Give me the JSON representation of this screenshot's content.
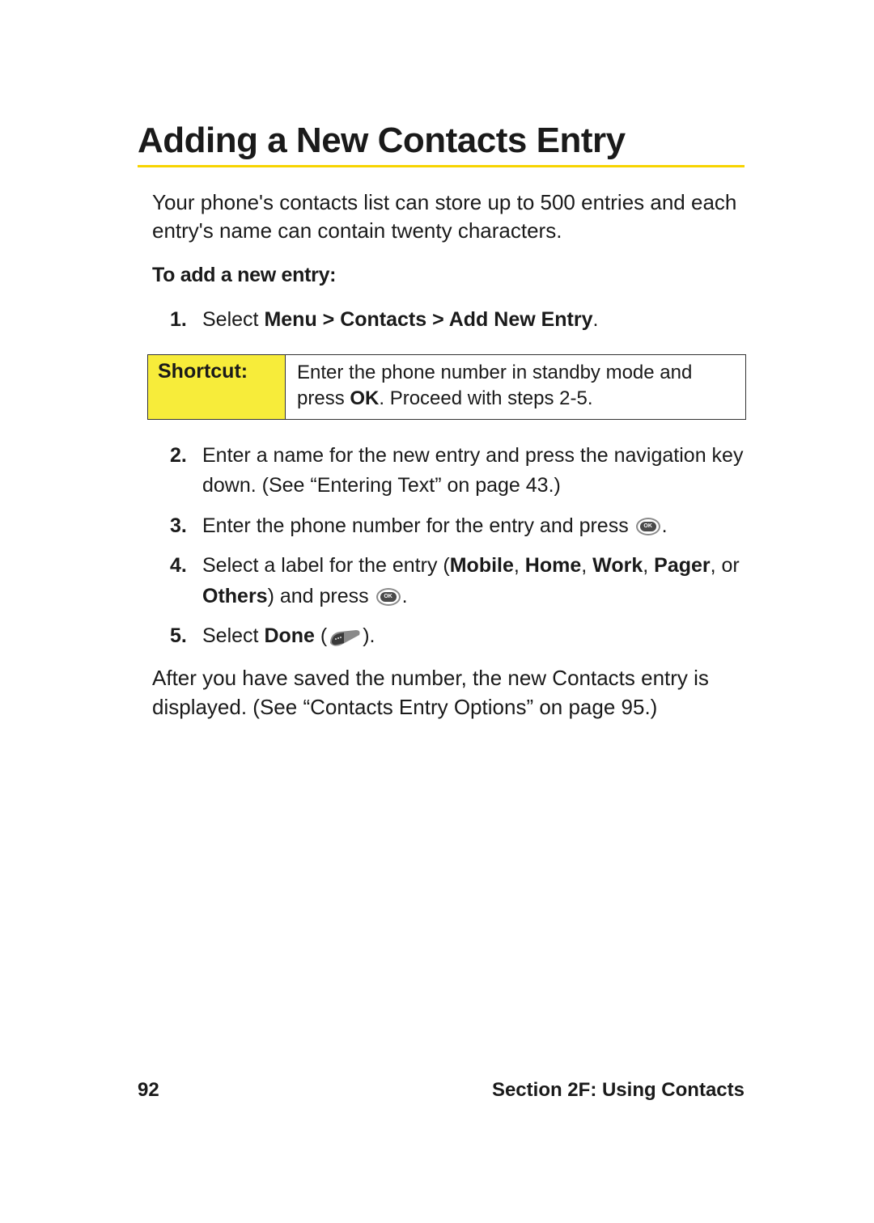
{
  "title": "Adding a New Contacts Entry",
  "intro": "Your phone's contacts list can store up to 500 entries and each entry's name can contain twenty characters.",
  "subhead": "To add a new entry:",
  "steps": {
    "s1": {
      "num": "1.",
      "pre": "Select ",
      "bold": "Menu > Contacts > Add New Entry",
      "post": "."
    },
    "s2": {
      "num": "2.",
      "text": "Enter a name for the new entry and press the navigation key down. (See “Entering Text” on page 43.)"
    },
    "s3": {
      "num": "3.",
      "pre": "Enter the phone number for the entry and press ",
      "post": "."
    },
    "s4": {
      "num": "4.",
      "pre": "Select a label for the entry (",
      "b1": "Mobile",
      "c1": ", ",
      "b2": "Home",
      "c2": ", ",
      "b3": "Work",
      "c3": ", ",
      "b4": "Pager",
      "c4": ", or ",
      "b5": "Others",
      "mid": ") and press ",
      "post": "."
    },
    "s5": {
      "num": "5.",
      "pre": "Select ",
      "bold": "Done",
      "mid": " (",
      "post": ")."
    }
  },
  "shortcut": {
    "label": "Shortcut:",
    "text_pre": "Enter the phone number in standby mode and press ",
    "text_bold": "OK",
    "text_post": ". Proceed with steps 2-5."
  },
  "after": "After you have saved the number, the new Contacts entry is displayed. (See “Contacts Entry Options” on page 95.)",
  "footer": {
    "page": "92",
    "section": "Section 2F: Using Contacts"
  },
  "icons": {
    "ok_label": "OK"
  }
}
